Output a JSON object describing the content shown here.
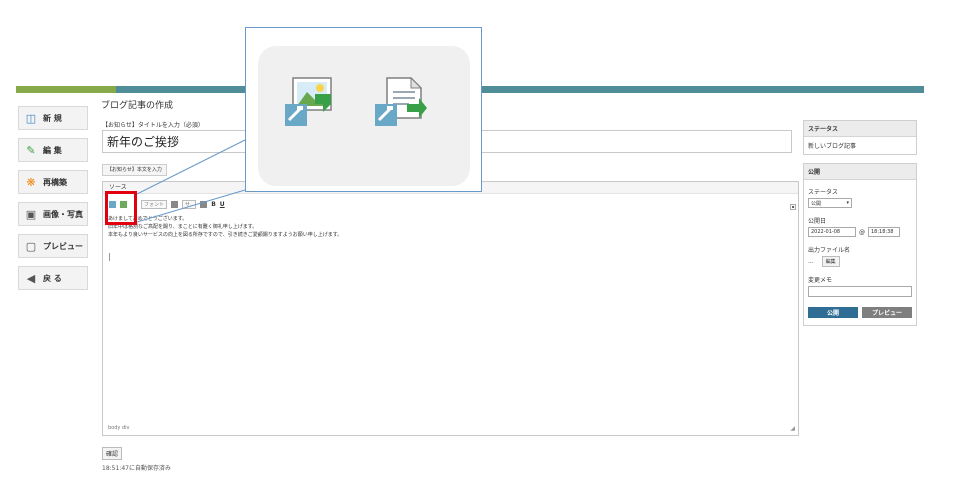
{
  "page_title": "ブログ記事の作成",
  "sidebar": {
    "items": [
      {
        "label": "新 規",
        "icon": "new-page-icon"
      },
      {
        "label": "編 集",
        "icon": "edit-icon"
      },
      {
        "label": "再構築",
        "icon": "rebuild-icon"
      },
      {
        "label": "画像・写真",
        "icon": "camera-icon"
      },
      {
        "label": "プレビュー",
        "icon": "monitor-icon"
      },
      {
        "label": "戻 る",
        "icon": "back-icon"
      }
    ]
  },
  "form": {
    "title_label": "【お知らせ】タイトルを入力（必須）",
    "title_value": "新年のご挨拶",
    "body_label": "【お知らせ】本文を入力"
  },
  "editor": {
    "toolbar_row1": [
      "ソース",
      "",
      "",
      "",
      "",
      ""
    ],
    "toolbar_row2": {
      "format_select": "フォント",
      "size_select": "サ..",
      "bold": "B",
      "underline": "U"
    },
    "lines": [
      "あけましておめでとうございます。",
      "旧年中は格別なご高配を賜り、まことに有難く御礼申し上げます。",
      "本年もより良いサービスの向上を図る所存ですので、引き続きご愛顧賜りますようお願い申し上げます。"
    ],
    "status_path": "body  div"
  },
  "status_panel": {
    "heading": "ステータス",
    "value": "新しいブログ記事"
  },
  "publish_panel": {
    "heading": "公開",
    "status_label": "ステータス",
    "status_value": "公開",
    "date_label": "公開日",
    "date_value": "2022-01-08",
    "at": "@",
    "time_value": "18:18:38",
    "filename_label": "出力ファイル名",
    "filename_value": "...",
    "edit_button": "編集",
    "memo_label": "変更メモ",
    "publish_button": "公開",
    "preview_button": "プレビュー"
  },
  "footer": {
    "confirm_button": "確認",
    "autosave_text": "18:51:47に自動保存済み"
  },
  "colors": {
    "header_bar": "#4f8d98",
    "highlight_red": "#e0000f",
    "callout_blue": "#6a99c9",
    "publish_blue": "#2f6d95"
  }
}
